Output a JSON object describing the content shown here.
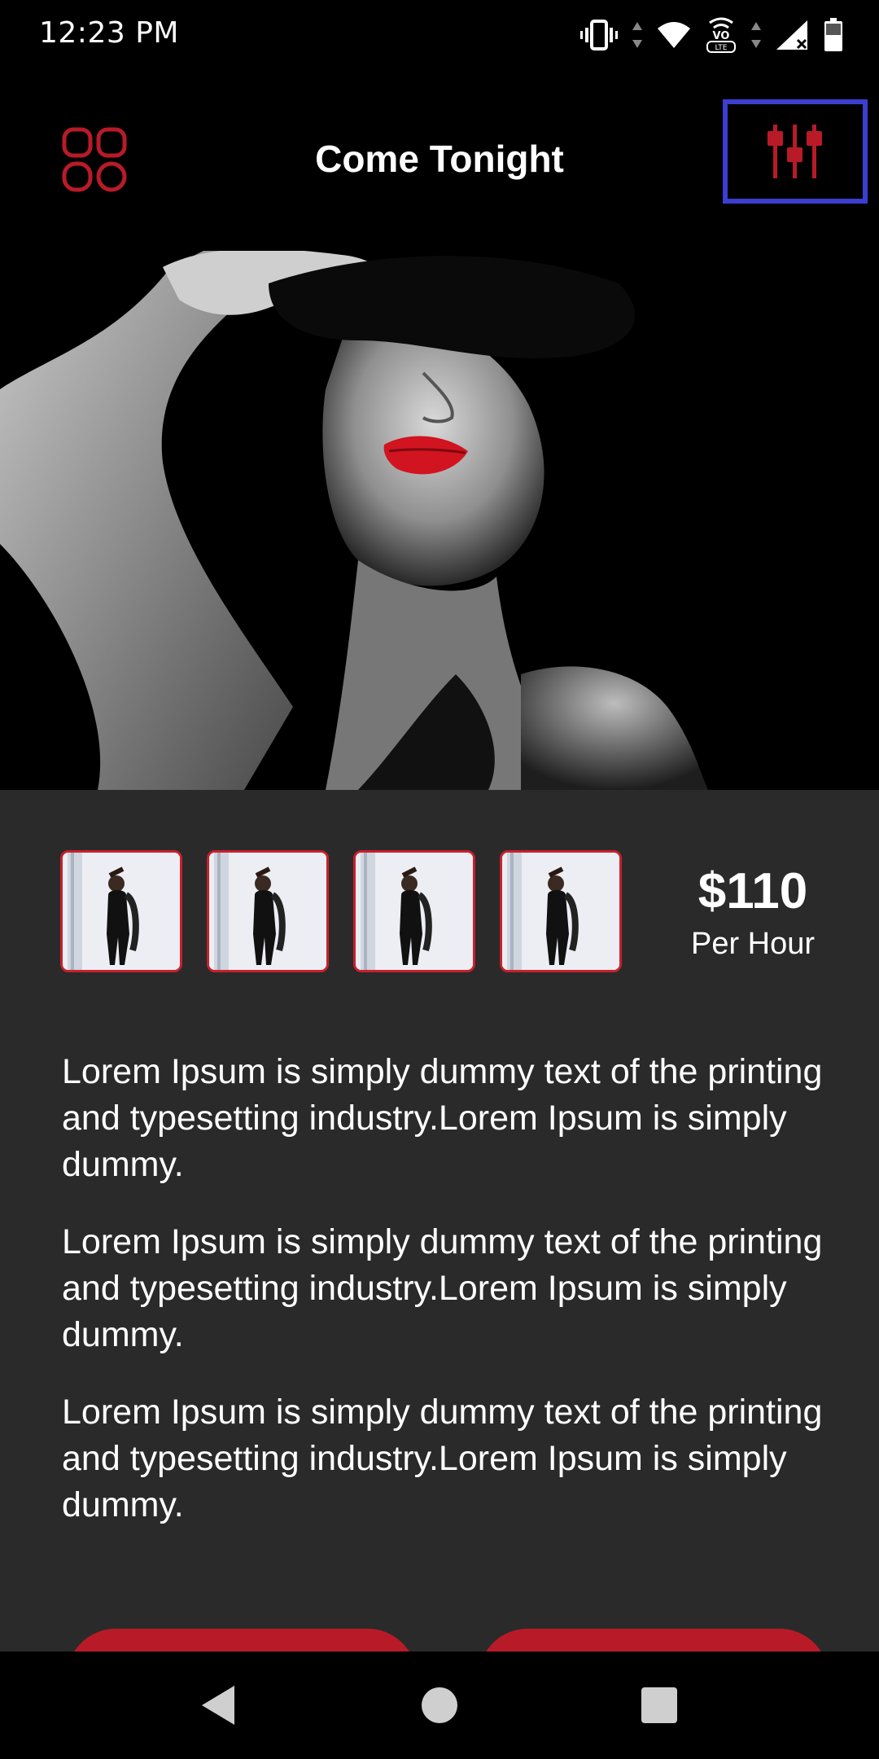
{
  "status_bar": {
    "time": "12:23 PM",
    "icons": [
      "vibrate-icon",
      "wifi-icon",
      "volte-icon",
      "signal-icon",
      "battery-icon"
    ],
    "volte_label": "LTE"
  },
  "app_bar": {
    "title": "Come Tonight",
    "menu_icon": "grid-menu-icon",
    "filter_icon": "filter-sliders-icon"
  },
  "gallery": {
    "thumbnail_count": 4
  },
  "price": {
    "amount": "$110",
    "unit": "Per Hour"
  },
  "description": [
    "Lorem Ipsum is simply dummy text of the printing and typesetting industry.Lorem Ipsum is simply dummy.",
    "Lorem Ipsum is simply dummy text of the printing and typesetting industry.Lorem Ipsum is simply dummy.",
    "Lorem Ipsum is simply dummy text of the printing and typesetting industry.Lorem Ipsum is simply dummy."
  ],
  "colors": {
    "accent": "#b81b27",
    "background": "#2a2a2b",
    "bar": "#000000",
    "focus_outline": "#3b3fd0"
  },
  "navigation": [
    "back-icon",
    "home-icon",
    "recents-icon"
  ]
}
